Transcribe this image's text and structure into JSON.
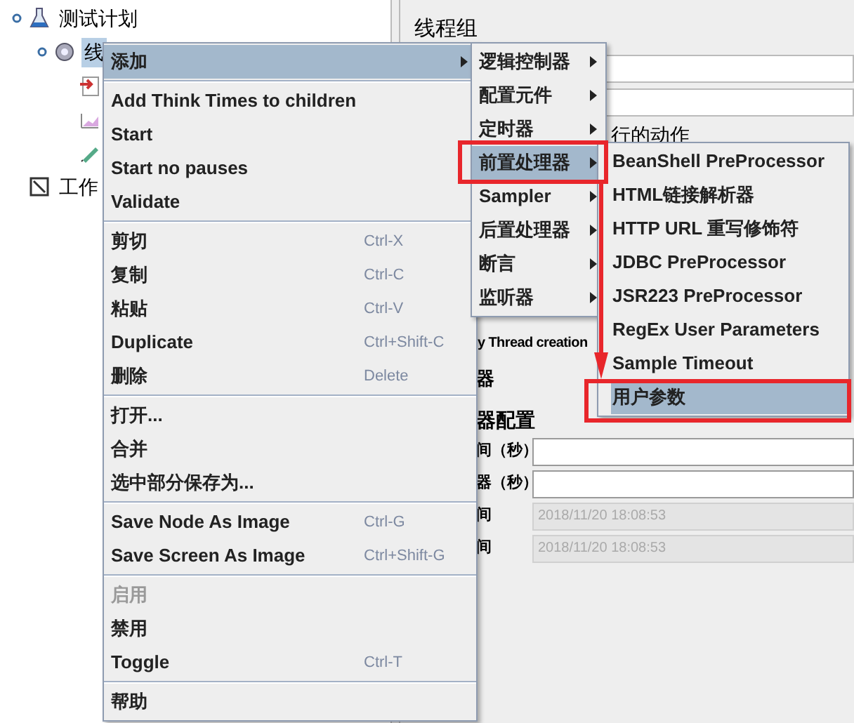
{
  "tree": {
    "items": [
      {
        "label": "测试计划",
        "selected": false,
        "children": [
          {
            "label": "线",
            "selected": true,
            "children": [
              {
                "selected": false
              },
              {
                "selected": false
              },
              {
                "selected": false
              }
            ]
          }
        ]
      },
      {
        "label": "工作",
        "selected": false
      }
    ]
  },
  "panel": {
    "title": "线程组",
    "section_fragment": "行的动作",
    "thread_fragment": "y Thread creation",
    "label_fragment": "器",
    "scheduler_fragment": "器配置",
    "rows": [
      {
        "label": "间（秒）",
        "disabled": false
      },
      {
        "label": "器（秒）",
        "disabled": false
      },
      {
        "label": "间",
        "value": "2018/11/20 18:08:53",
        "disabled": true
      },
      {
        "label": "间",
        "value": "2018/11/20 18:08:53",
        "disabled": true
      }
    ]
  },
  "menus": [
    {
      "items": [
        {
          "kind": "item",
          "label": "添加",
          "selected": true,
          "disabled": false,
          "submenu": true
        },
        {
          "kind": "separator"
        },
        {
          "kind": "item",
          "label": "Add Think Times to children",
          "selected": false,
          "disabled": false,
          "submenu": false
        },
        {
          "kind": "item",
          "label": "Start",
          "selected": false,
          "disabled": false,
          "submenu": false
        },
        {
          "kind": "item",
          "label": "Start no pauses",
          "selected": false,
          "disabled": false,
          "submenu": false
        },
        {
          "kind": "item",
          "label": "Validate",
          "selected": false,
          "disabled": false,
          "submenu": false
        },
        {
          "kind": "separator"
        },
        {
          "kind": "item",
          "label": "剪切",
          "shortcut": "Ctrl-X",
          "selected": false,
          "disabled": false,
          "submenu": false
        },
        {
          "kind": "item",
          "label": "复制",
          "shortcut": "Ctrl-C",
          "selected": false,
          "disabled": false,
          "submenu": false
        },
        {
          "kind": "item",
          "label": "粘贴",
          "shortcut": "Ctrl-V",
          "selected": false,
          "disabled": false,
          "submenu": false
        },
        {
          "kind": "item",
          "label": "Duplicate",
          "shortcut": "Ctrl+Shift-C",
          "selected": false,
          "disabled": false,
          "submenu": false
        },
        {
          "kind": "item",
          "label": "删除",
          "shortcut": "Delete",
          "selected": false,
          "disabled": false,
          "submenu": false
        },
        {
          "kind": "separator"
        },
        {
          "kind": "item",
          "label": "打开...",
          "selected": false,
          "disabled": false,
          "submenu": false
        },
        {
          "kind": "item",
          "label": "合并",
          "selected": false,
          "disabled": false,
          "submenu": false
        },
        {
          "kind": "item",
          "label": "选中部分保存为...",
          "selected": false,
          "disabled": false,
          "submenu": false
        },
        {
          "kind": "separator"
        },
        {
          "kind": "item",
          "label": "Save Node As Image",
          "shortcut": "Ctrl-G",
          "selected": false,
          "disabled": false,
          "submenu": false
        },
        {
          "kind": "item",
          "label": "Save Screen As Image",
          "shortcut": "Ctrl+Shift-G",
          "selected": false,
          "disabled": false,
          "submenu": false
        },
        {
          "kind": "separator"
        },
        {
          "kind": "item",
          "label": "启用",
          "selected": false,
          "disabled": true,
          "submenu": false
        },
        {
          "kind": "item",
          "label": "禁用",
          "selected": false,
          "disabled": false,
          "submenu": false
        },
        {
          "kind": "item",
          "label": "Toggle",
          "shortcut": "Ctrl-T",
          "selected": false,
          "disabled": false,
          "submenu": false
        },
        {
          "kind": "separator"
        },
        {
          "kind": "item",
          "label": "帮助",
          "selected": false,
          "disabled": false,
          "submenu": false
        }
      ]
    },
    {
      "items": [
        {
          "kind": "item",
          "label": "逻辑控制器",
          "selected": false,
          "disabled": false,
          "submenu": true
        },
        {
          "kind": "item",
          "label": "配置元件",
          "selected": false,
          "disabled": false,
          "submenu": true
        },
        {
          "kind": "item",
          "label": "定时器",
          "selected": false,
          "disabled": false,
          "submenu": true
        },
        {
          "kind": "item",
          "label": "前置处理器",
          "selected": true,
          "disabled": false,
          "submenu": true
        },
        {
          "kind": "item",
          "label": "Sampler",
          "selected": false,
          "disabled": false,
          "submenu": true
        },
        {
          "kind": "item",
          "label": "后置处理器",
          "selected": false,
          "disabled": false,
          "submenu": true
        },
        {
          "kind": "item",
          "label": "断言",
          "selected": false,
          "disabled": false,
          "submenu": true
        },
        {
          "kind": "item",
          "label": "监听器",
          "selected": false,
          "disabled": false,
          "submenu": true
        }
      ]
    },
    {
      "items": [
        {
          "kind": "item",
          "label": "BeanShell PreProcessor",
          "selected": false,
          "disabled": false,
          "submenu": false
        },
        {
          "kind": "item",
          "label": "HTML链接解析器",
          "selected": false,
          "disabled": false,
          "submenu": false
        },
        {
          "kind": "item",
          "label": "HTTP URL 重写修饰符",
          "selected": false,
          "disabled": false,
          "submenu": false
        },
        {
          "kind": "item",
          "label": "JDBC PreProcessor",
          "selected": false,
          "disabled": false,
          "submenu": false
        },
        {
          "kind": "item",
          "label": "JSR223 PreProcessor",
          "selected": false,
          "disabled": false,
          "submenu": false
        },
        {
          "kind": "item",
          "label": "RegEx User Parameters",
          "selected": false,
          "disabled": false,
          "submenu": false
        },
        {
          "kind": "item",
          "label": "Sample Timeout",
          "selected": false,
          "disabled": false,
          "submenu": false
        },
        {
          "kind": "item",
          "label": "用户参数",
          "selected": true,
          "disabled": false,
          "submenu": false
        }
      ]
    }
  ]
}
